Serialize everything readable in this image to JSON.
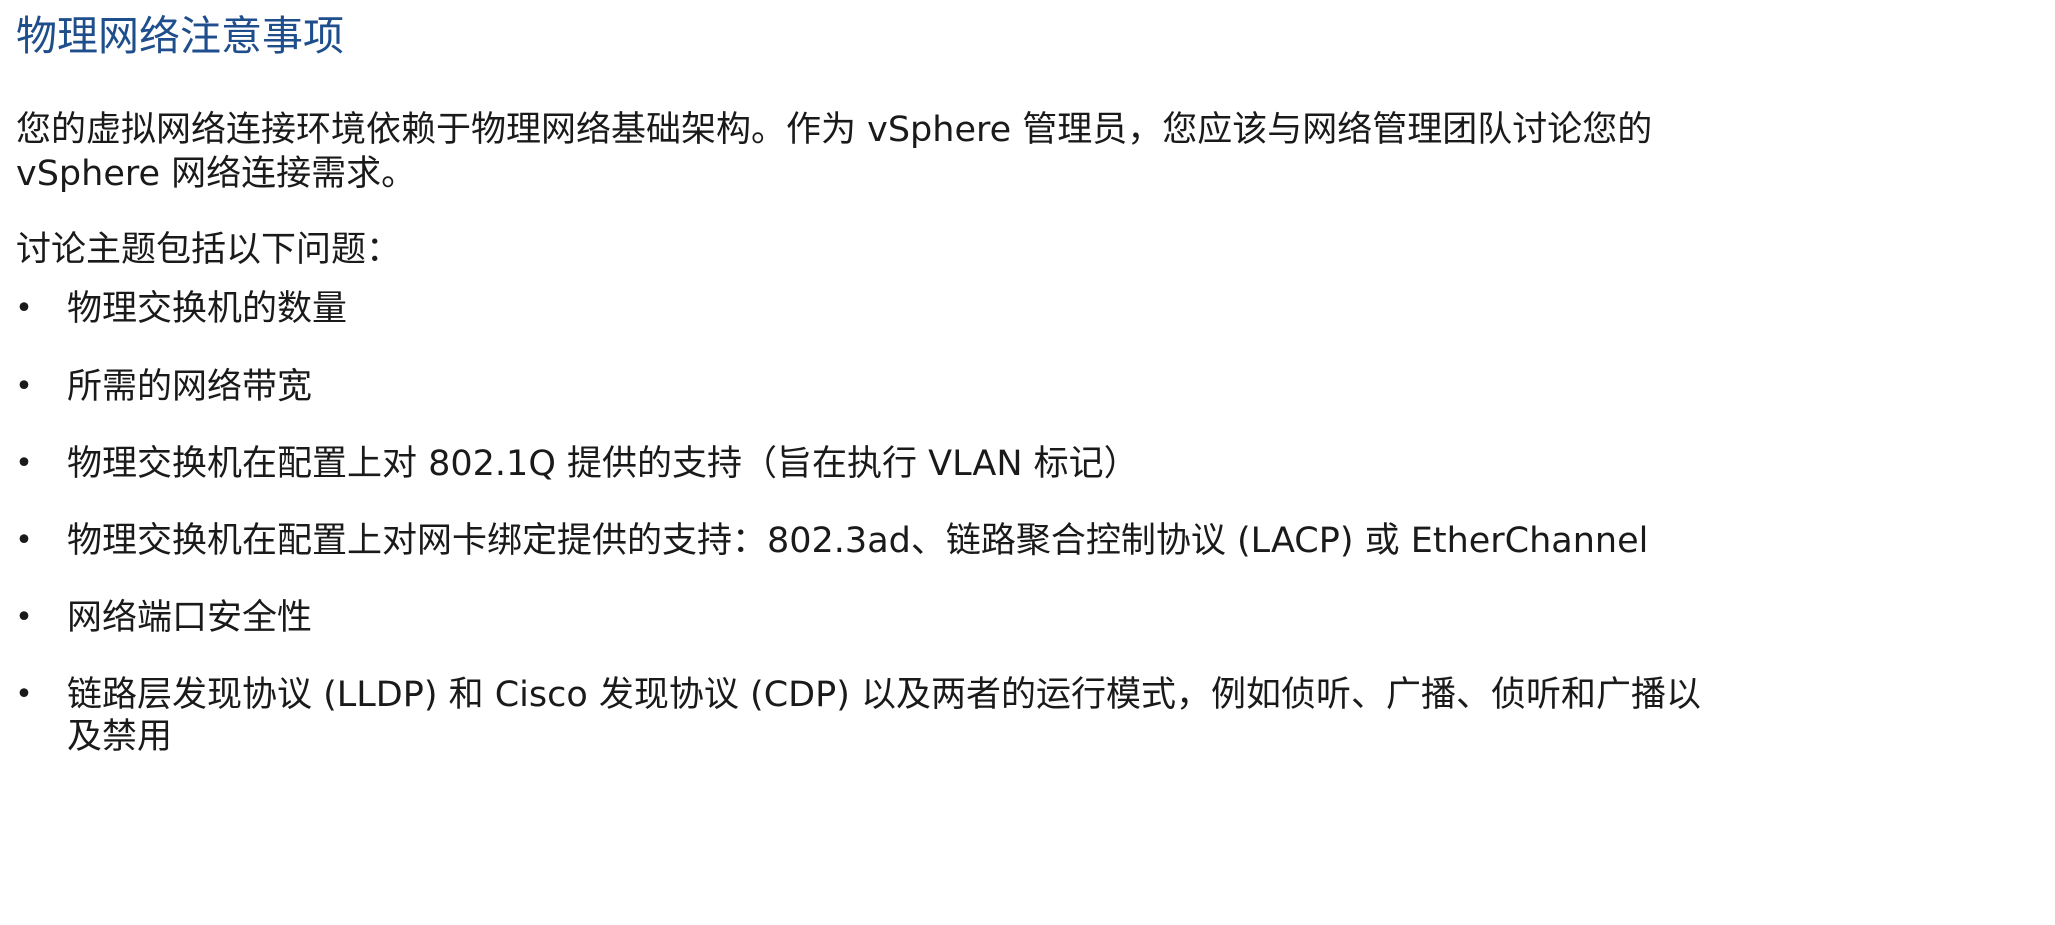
{
  "title": "物理网络注意事项",
  "intro": {
    "line1": "您的虚拟网络连接环境依赖于物理网络基础架构。作为 vSphere 管理员，您应该与网络管理团队讨论您的",
    "line2": "vSphere 网络连接需求。"
  },
  "lead": "讨论主题包括以下问题：",
  "bullet_symbol": "•",
  "bullets": [
    {
      "line1": "物理交换机的数量",
      "line2": ""
    },
    {
      "line1": "所需的网络带宽",
      "line2": ""
    },
    {
      "line1": "物理交换机在配置上对 802.1Q 提供的支持（旨在执行 VLAN 标记）",
      "line2": ""
    },
    {
      "line1": "物理交换机在配置上对网卡绑定提供的支持：802.3ad、链路聚合控制协议 (LACP) 或 EtherChannel",
      "line2": ""
    },
    {
      "line1": "网络端口安全性",
      "line2": ""
    },
    {
      "line1": "链路层发现协议 (LLDP) 和 Cisco 发现协议 (CDP) 以及两者的运行模式，例如侦听、广播、侦听和广播以",
      "line2": "及禁用"
    }
  ],
  "colors": {
    "title": "#1f4e8c",
    "text": "#1a1a1a",
    "background": "#ffffff"
  }
}
